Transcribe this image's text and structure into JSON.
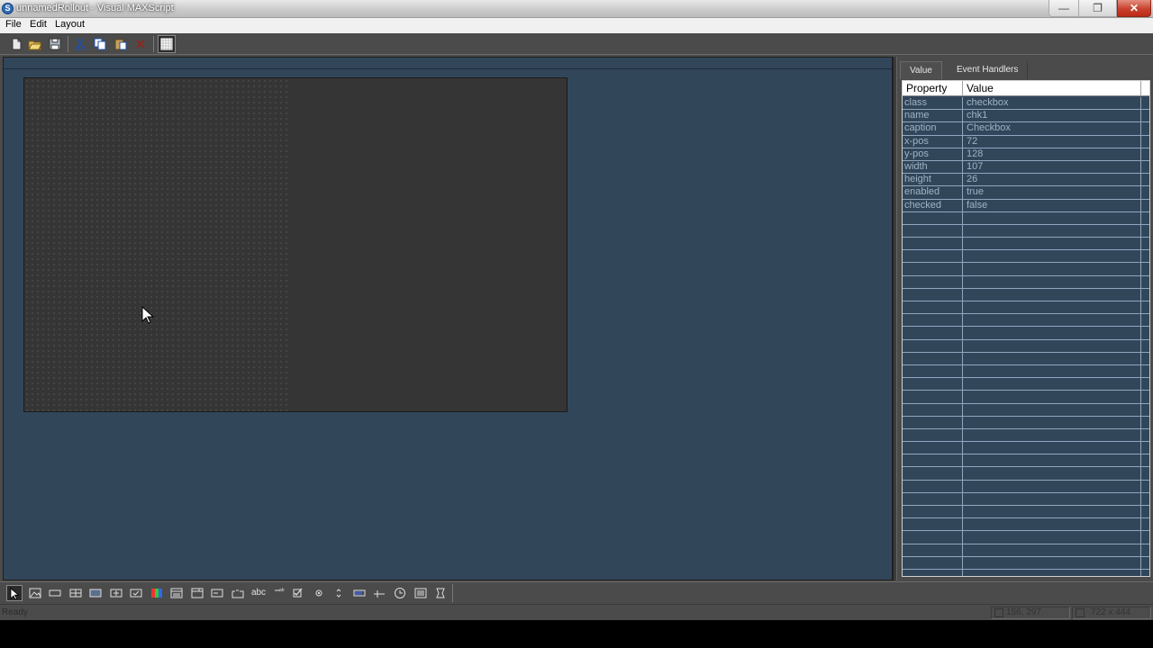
{
  "window": {
    "title": "unnamedRollout - Visual MAXScript",
    "app_icon": "maxscript-logo-icon",
    "minimize": "minimize-icon",
    "maximize": "restore-icon",
    "close": "close-icon"
  },
  "menu": {
    "items": [
      "File",
      "Edit",
      "Layout"
    ]
  },
  "toolbar": {
    "icons": [
      "new-icon",
      "open-icon",
      "save-icon",
      "cut-icon",
      "copy-icon",
      "paste-icon",
      "delete-icon",
      "grid-toggle-icon"
    ]
  },
  "properties": {
    "tabs": [
      "Value",
      "Event Handlers"
    ],
    "header": {
      "property": "Property",
      "value": "Value"
    },
    "rows": [
      {
        "property": "class",
        "value": "checkbox"
      },
      {
        "property": "name",
        "value": "chk1"
      },
      {
        "property": "caption",
        "value": "Checkbox"
      },
      {
        "property": "x-pos",
        "value": "72"
      },
      {
        "property": "y-pos",
        "value": "128"
      },
      {
        "property": "width",
        "value": "107"
      },
      {
        "property": "height",
        "value": "26"
      },
      {
        "property": "enabled",
        "value": "true"
      },
      {
        "property": "checked",
        "value": "false"
      }
    ],
    "empty_rows": 28
  },
  "controls": {
    "items": [
      "select-pointer-icon",
      "bitmap-icon",
      "button-icon",
      "map-button-icon",
      "material-button-icon",
      "pick-button-icon",
      "checkbutton-icon",
      "color-picker-icon",
      "combobox-icon",
      "dropdown-icon",
      "edittext-icon",
      "groupbox-icon",
      "label-icon",
      "hyperlink-icon",
      "checkbox-icon",
      "radiobuttons-icon",
      "spinner-icon",
      "progressbar-icon",
      "slider-icon",
      "timer-icon",
      "listbox-icon",
      "activex-icon"
    ],
    "label_text": "abc"
  },
  "status": {
    "text": "Ready",
    "coords": "156, 297",
    "size": "722 x 444"
  },
  "colors": {
    "canvas": "#32465a",
    "rollout": "#353535",
    "chrome": "#4b4b4b",
    "close_button": "#c8412e"
  }
}
